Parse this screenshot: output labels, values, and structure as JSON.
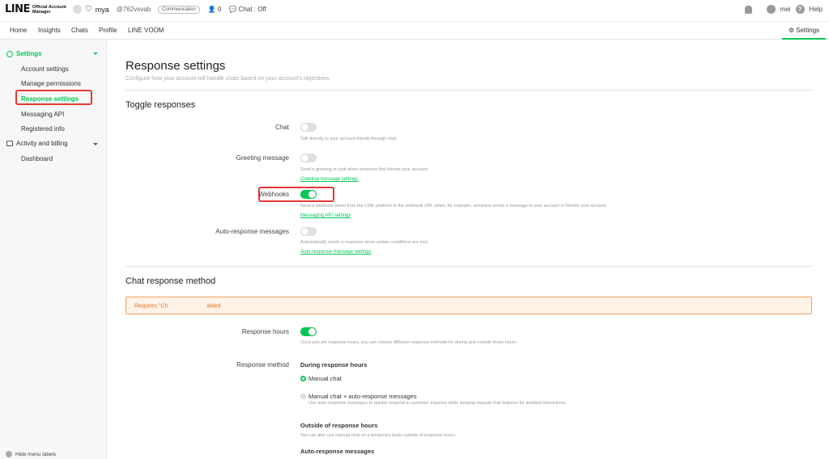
{
  "header": {
    "logo_main": "LINE",
    "logo_sub_1": "Official Account",
    "logo_sub_2": "Manager",
    "account_name": "mya",
    "account_id": "@762vsvab",
    "badge": "Communication",
    "friends": "0",
    "chat_status": "Chat : Off",
    "user_name": "mei",
    "help": "Help"
  },
  "nav": {
    "tabs": [
      "Home",
      "Insights",
      "Chats",
      "Profile",
      "LINE VOOM"
    ],
    "settings": "Settings"
  },
  "sidebar": {
    "settings_group": "Settings",
    "items": [
      "Account settings",
      "Manage permissions",
      "Response settings",
      "Messaging API",
      "Registered info"
    ],
    "billing_group": "Activity and billing",
    "billing_items": [
      "Dashboard"
    ],
    "hide_labels": "Hide menu labels"
  },
  "main": {
    "title": "Response settings",
    "description": "Configure how your account will handle chats based on your account's objectives.",
    "toggle_section": "Toggle responses",
    "toggles": [
      {
        "label": "Chat",
        "on": false,
        "help": "Talk directly to your account friends through chat.",
        "link": ""
      },
      {
        "label": "Greeting message",
        "on": false,
        "help": "Send a greeting in chat when someone first friends your account.",
        "link": "Greeting message settings"
      },
      {
        "label": "Webhooks",
        "on": true,
        "help": "Send a webhook event from the LINE platform to the webhook URL when, for example, someone sends a message to your account or friends your account.",
        "link": "Messaging API settings"
      },
      {
        "label": "Auto-response messages",
        "on": false,
        "help": "Automatically sends a response when certain conditions are met.",
        "link": "Auto-response message settings"
      }
    ],
    "method_section": "Chat response method",
    "warning_start": "Requires \"Ch",
    "warning_end": "abled",
    "response_hours_label": "Response hours",
    "response_hours_on": true,
    "response_hours_help": "Once you set response hours, you can choose different response methods for during and outside those hours.",
    "response_method_label": "Response method",
    "during_hours": "During response hours",
    "radio_manual": "Manual chat",
    "radio_manual_auto": "Manual chat + auto-response messages",
    "radio_manual_auto_help": "Use auto-response messages to quickly respond to customer inquiries while keeping manual chat features for detailed interactions.",
    "outside_hours": "Outside of response hours",
    "outside_hours_help": "You can also use manual chat on a temporary basis outside of response hours.",
    "auto_response_messages": "Auto-response messages"
  },
  "colors": {
    "accent": "#06c755",
    "highlight": "#e53935",
    "warning": "#e07020"
  }
}
